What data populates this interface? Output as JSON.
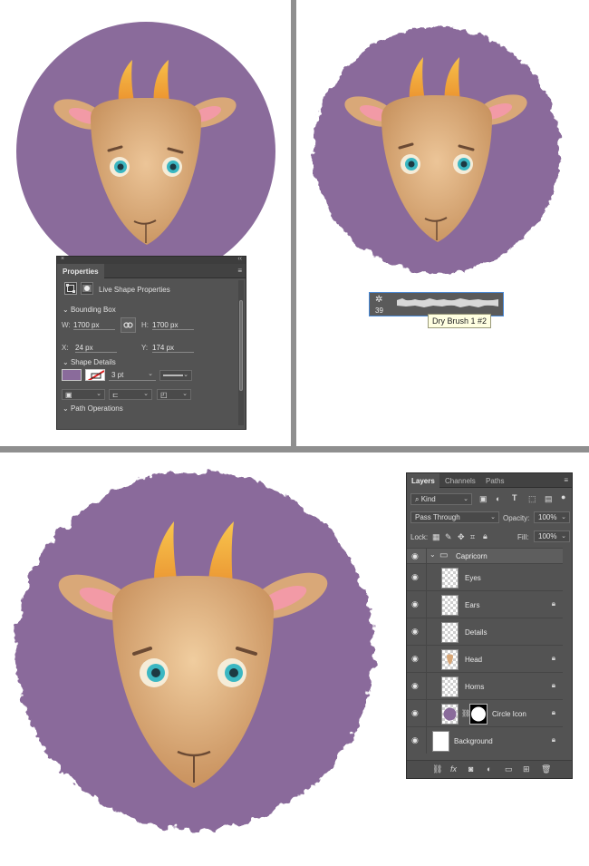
{
  "properties_panel": {
    "tab": "Properties",
    "header": "Live Shape Properties",
    "bounding_box": {
      "section": "Bounding Box",
      "w_label": "W:",
      "w_value": "1700 px",
      "h_label": "H:",
      "h_value": "1700 px",
      "x_label": "X:",
      "x_value": "24 px",
      "y_label": "Y:",
      "y_value": "174 px"
    },
    "shape_details": {
      "section": "Shape Details",
      "fill_color": "#8a6b9b",
      "stroke_width": "3 pt"
    },
    "path_operations": "Path Operations"
  },
  "brush_picker": {
    "size": "39",
    "tooltip": "Dry Brush 1 #2"
  },
  "layers_panel": {
    "tabs": [
      "Layers",
      "Channels",
      "Paths"
    ],
    "filter_kind": "Kind",
    "blend_mode": "Pass Through",
    "opacity_label": "Opacity:",
    "opacity_value": "100%",
    "lock_label": "Lock:",
    "fill_label": "Fill:",
    "fill_value": "100%",
    "group_name": "Capricorn",
    "layers": [
      {
        "name": "Eyes",
        "locked": false
      },
      {
        "name": "Ears",
        "locked": true
      },
      {
        "name": "Details",
        "locked": false
      },
      {
        "name": "Head",
        "locked": true
      },
      {
        "name": "Horns",
        "locked": true
      },
      {
        "name": "Circle Icon",
        "locked": true
      },
      {
        "name": "Background",
        "locked": true
      }
    ]
  },
  "colors": {
    "circle_purple": "#8a6b9b",
    "head_tan": "#d9a878",
    "horn_orange": "#f0a73a",
    "eye_teal": "#3bb7c2",
    "ear_pink": "#f29aa6"
  }
}
